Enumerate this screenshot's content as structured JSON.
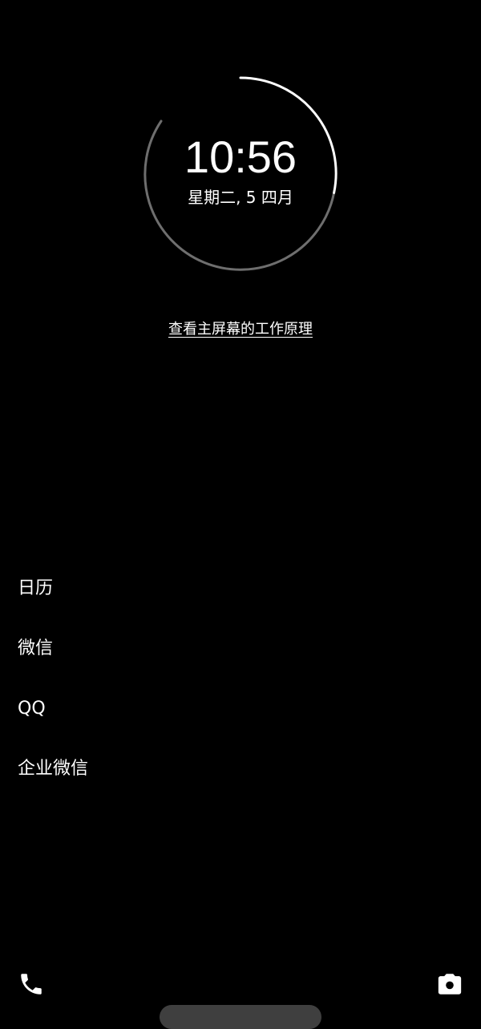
{
  "clock": {
    "time": "10:56",
    "date": "星期二, 5 四月"
  },
  "howto_link": "查看主屏幕的工作原理",
  "apps": [
    {
      "label": "日历"
    },
    {
      "label": "微信"
    },
    {
      "label": "QQ"
    },
    {
      "label": "企业微信"
    }
  ],
  "bottom_bar": {
    "left_icon": "phone-icon",
    "right_icon": "camera-icon"
  },
  "colors": {
    "background": "#000000",
    "text": "#ffffff",
    "ring_bright": "#ffffff",
    "ring_dim": "#6e6e6e",
    "home_pill": "#3f3f3f"
  }
}
